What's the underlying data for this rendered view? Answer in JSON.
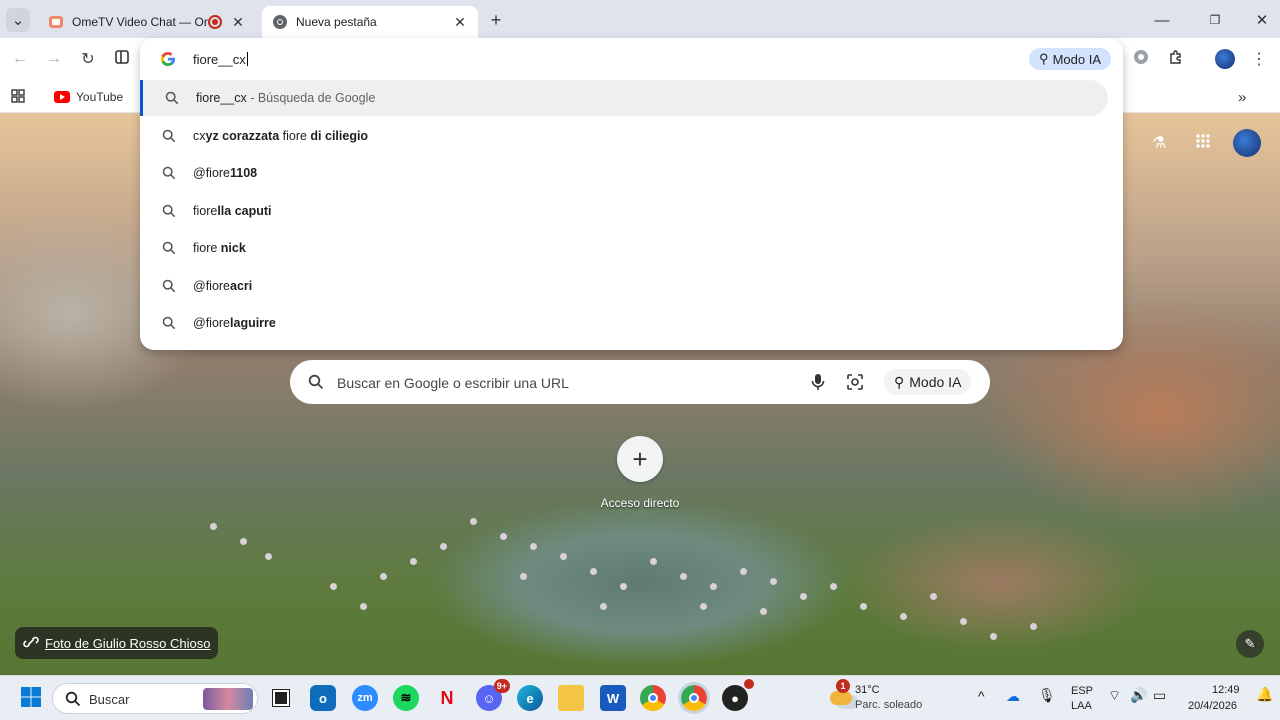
{
  "tabs": [
    {
      "title": "OmeTV Video Chat — Ome",
      "icon": "ometv-icon",
      "recording": true
    },
    {
      "title": "Nueva pestaña",
      "icon": "chrome-icon",
      "active": true
    }
  ],
  "bookmarks": [
    {
      "label": "YouTube",
      "icon": "youtube-icon"
    }
  ],
  "omnibox": {
    "value": "fiore__cx",
    "ai_mode_label": "Modo IA",
    "suggestions": [
      {
        "parts": [
          {
            "text": "fiore__cx",
            "bold": false
          }
        ],
        "description": " - Búsqueda de Google"
      },
      {
        "parts": [
          {
            "text": "cx",
            "bold": false
          },
          {
            "text": "yz corazzata",
            "bold": true
          },
          {
            "text": " fiore ",
            "bold": false
          },
          {
            "text": "di ciliegio",
            "bold": true
          }
        ]
      },
      {
        "parts": [
          {
            "text": "@fiore",
            "bold": false
          },
          {
            "text": "1108",
            "bold": true
          }
        ]
      },
      {
        "parts": [
          {
            "text": "fiore",
            "bold": false
          },
          {
            "text": "lla caputi",
            "bold": true
          }
        ]
      },
      {
        "parts": [
          {
            "text": "fiore ",
            "bold": false
          },
          {
            "text": "nick",
            "bold": true
          }
        ]
      },
      {
        "parts": [
          {
            "text": "@fiore",
            "bold": false
          },
          {
            "text": "acri",
            "bold": true
          }
        ]
      },
      {
        "parts": [
          {
            "text": "@fiore",
            "bold": false
          },
          {
            "text": "laguirre",
            "bold": true
          }
        ]
      }
    ]
  },
  "ntp": {
    "search_placeholder": "Buscar en Google o escribir una URL",
    "ai_mode_label": "Modo IA",
    "shortcut_label": "Acceso directo",
    "attribution": "Foto de Giulio Rosso Chioso"
  },
  "taskbar": {
    "search_placeholder": "Buscar",
    "weather_temp": "31°C",
    "weather_desc": "Parc. soleado",
    "weather_badge": "1",
    "discord_badge": "9+",
    "language_line1": "ESP",
    "language_line2": "LAA",
    "time": "12:49",
    "date": "20/4/2026"
  },
  "colors": {
    "accent": "#0b57d0",
    "ai_chip": "#d3e3fd",
    "tabstrip": "#dfe3ec"
  }
}
